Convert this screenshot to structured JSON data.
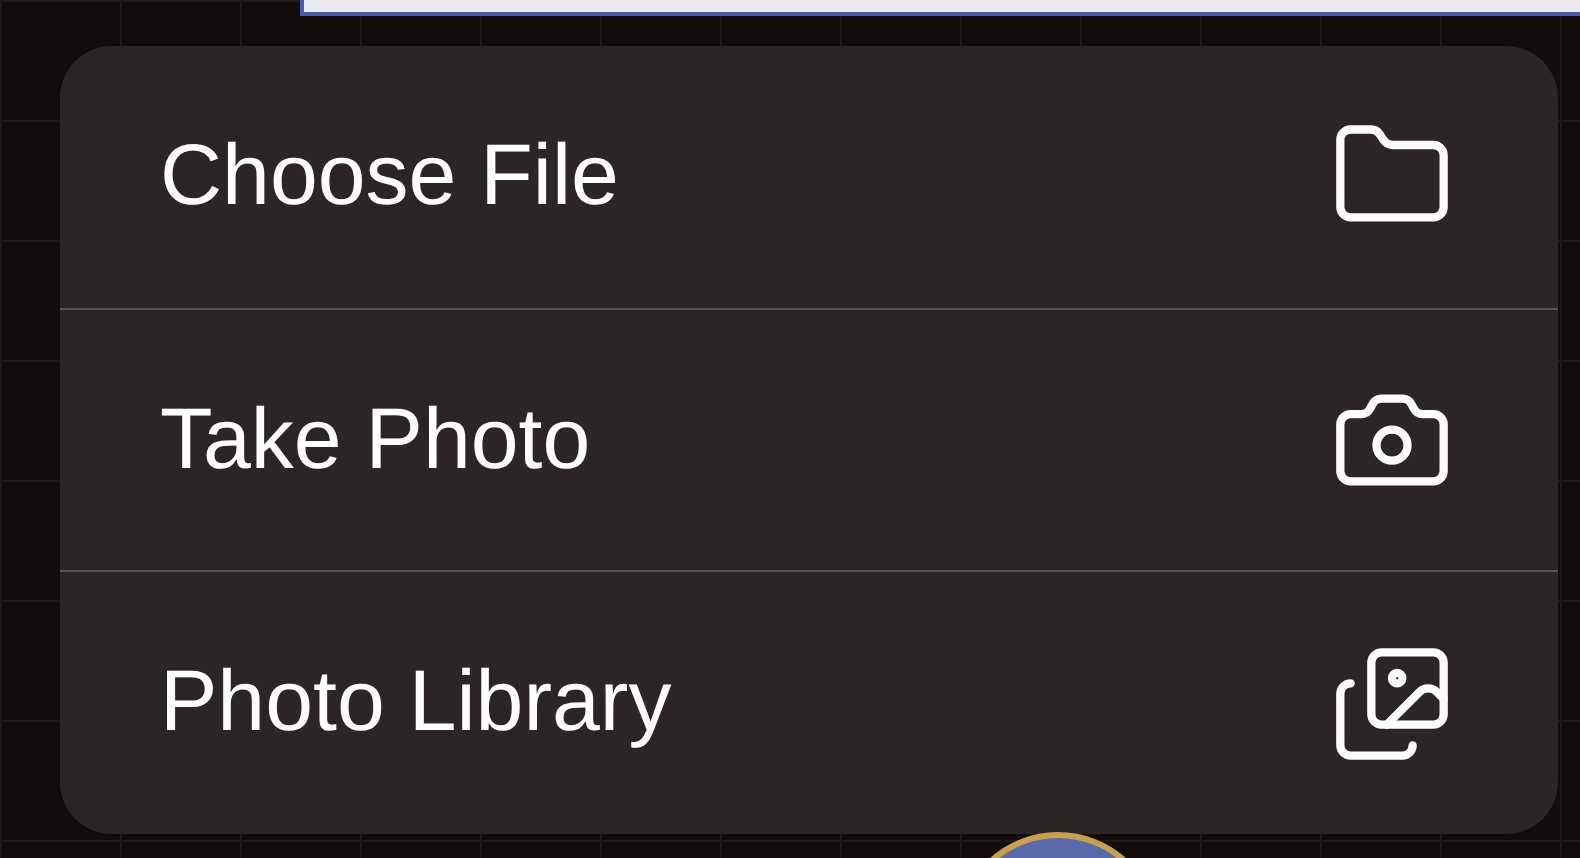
{
  "menu": {
    "items": [
      {
        "label": "Choose File",
        "kind": "folder"
      },
      {
        "label": "Take Photo",
        "kind": "camera"
      },
      {
        "label": "Photo Library",
        "kind": "library"
      }
    ]
  }
}
